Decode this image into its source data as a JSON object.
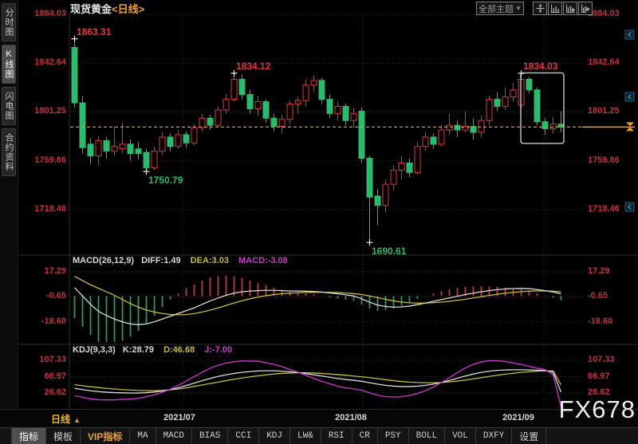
{
  "header": {
    "title_symbol": "现货黄金",
    "title_period": "<日线>",
    "theme_label": "全部主题",
    "theme_arrow": "▼"
  },
  "sidebar": {
    "items": [
      {
        "label": "分时图",
        "selected": false
      },
      {
        "label": "K线图",
        "selected": true
      },
      {
        "label": "闪电图",
        "selected": false
      },
      {
        "label": "合约资料",
        "selected": false
      }
    ]
  },
  "price_axis": {
    "labels": [
      "1884.03",
      "1842.64",
      "1801.25",
      "1759.86",
      "1718.46"
    ]
  },
  "macd": {
    "title": "MACD(26,12,9)",
    "diff_label": "DIFF:1.49",
    "dea_label": "DEA:3.03",
    "macd_label": "MACD:-3.08",
    "axis": [
      "17.29",
      "-0.65",
      "-18.60"
    ]
  },
  "kdj": {
    "title": "KDJ(9,3,3)",
    "k_label": "K:28.79",
    "d_label": "D:46.68",
    "j_label": "J:-7.00",
    "axis": [
      "107.33",
      "66.97",
      "26.62"
    ]
  },
  "timeline": {
    "period_label": "日线",
    "arrow": "▲",
    "dates": [
      "2021/07",
      "2021/08",
      "2021/09"
    ]
  },
  "watermark": "FX678",
  "toolbar": {
    "items": [
      {
        "label": "指标",
        "state": "selected"
      },
      {
        "label": "模板"
      },
      {
        "label": "VIP指标",
        "state": "vip"
      },
      {
        "label": "MA"
      },
      {
        "label": "MACD"
      },
      {
        "label": "BIAS"
      },
      {
        "label": "CCI"
      },
      {
        "label": "KDJ"
      },
      {
        "label": "LW&"
      },
      {
        "label": "RSI"
      },
      {
        "label": "CR"
      },
      {
        "label": "PSY"
      },
      {
        "label": "BOLL"
      },
      {
        "label": "VOL"
      },
      {
        "label": "DXFY"
      },
      {
        "label": "设置"
      }
    ]
  },
  "colors": {
    "up": "#e23345",
    "down": "#2eb96d",
    "axis": "#c5303c",
    "accent": "#f7a01e",
    "dea_yellow": "#c6bd2d",
    "magenta": "#cf35cf",
    "line_white": "#dadada",
    "hist_up": "#cf3344",
    "hist_down": "#2a9b5e"
  },
  "chart_data": {
    "type": "candlestick",
    "symbol": "现货黄金",
    "period": "日线",
    "price_axis_ticks": [
      1884.03,
      1842.64,
      1801.25,
      1759.86,
      1718.46
    ],
    "x_axis_labels": [
      "2021/07",
      "2021/08",
      "2021/09"
    ],
    "last_price": 1788.5,
    "candles": [
      [
        1856,
        1863.31,
        1805,
        1809
      ],
      [
        1809,
        1815,
        1766,
        1771
      ],
      [
        1774,
        1779,
        1757,
        1764
      ],
      [
        1764,
        1781,
        1756,
        1777
      ],
      [
        1777,
        1780,
        1762,
        1768
      ],
      [
        1768,
        1789,
        1764,
        1772
      ],
      [
        1770,
        1792,
        1766,
        1774
      ],
      [
        1774,
        1778,
        1760,
        1766
      ],
      [
        1770,
        1776,
        1761,
        1766
      ],
      [
        1767,
        1770,
        1750.79,
        1754
      ],
      [
        1754,
        1772,
        1752,
        1768
      ],
      [
        1768,
        1784,
        1765,
        1780
      ],
      [
        1780,
        1783,
        1768,
        1772
      ],
      [
        1772,
        1786,
        1770,
        1782
      ],
      [
        1782,
        1785,
        1771,
        1775
      ],
      [
        1775,
        1791,
        1773,
        1788
      ],
      [
        1788,
        1800,
        1785,
        1796
      ],
      [
        1796,
        1799,
        1786,
        1790
      ],
      [
        1790,
        1806,
        1788,
        1803
      ],
      [
        1803,
        1816,
        1800,
        1812
      ],
      [
        1812,
        1834.12,
        1810,
        1829
      ],
      [
        1829,
        1833,
        1812,
        1816
      ],
      [
        1816,
        1820,
        1800,
        1804
      ],
      [
        1804,
        1815,
        1798,
        1810
      ],
      [
        1810,
        1812,
        1792,
        1796
      ],
      [
        1796,
        1800,
        1785,
        1789
      ],
      [
        1789,
        1799,
        1783,
        1795
      ],
      [
        1795,
        1811,
        1791,
        1808
      ],
      [
        1808,
        1814,
        1800,
        1811
      ],
      [
        1811,
        1829,
        1806,
        1824
      ],
      [
        1824,
        1832,
        1818,
        1828
      ],
      [
        1828,
        1830,
        1808,
        1812
      ],
      [
        1812,
        1816,
        1796,
        1800
      ],
      [
        1800,
        1810,
        1794,
        1806
      ],
      [
        1806,
        1808,
        1790,
        1794
      ],
      [
        1794,
        1805,
        1788,
        1800
      ],
      [
        1802,
        1805,
        1758,
        1762
      ],
      [
        1762,
        1764,
        1690.61,
        1729
      ],
      [
        1730,
        1736,
        1705,
        1722
      ],
      [
        1722,
        1744,
        1716,
        1740
      ],
      [
        1740,
        1756,
        1735,
        1752
      ],
      [
        1752,
        1764,
        1744,
        1758
      ],
      [
        1758,
        1762,
        1746,
        1750
      ],
      [
        1750,
        1776,
        1748,
        1772
      ],
      [
        1772,
        1784,
        1768,
        1780
      ],
      [
        1780,
        1783,
        1770,
        1774
      ],
      [
        1774,
        1790,
        1772,
        1786
      ],
      [
        1786,
        1800,
        1782,
        1790
      ],
      [
        1790,
        1794,
        1780,
        1786
      ],
      [
        1786,
        1802,
        1784,
        1789
      ],
      [
        1789,
        1796,
        1778,
        1784
      ],
      [
        1784,
        1798,
        1780,
        1794
      ],
      [
        1794,
        1815,
        1790,
        1812
      ],
      [
        1812,
        1818,
        1802,
        1806
      ],
      [
        1806,
        1822,
        1803,
        1814
      ],
      [
        1814,
        1826,
        1810,
        1820
      ],
      [
        1807,
        1834.03,
        1804,
        1829
      ],
      [
        1829,
        1831,
        1817,
        1820
      ],
      [
        1820,
        1822,
        1790,
        1793
      ],
      [
        1793,
        1796,
        1782,
        1787
      ],
      [
        1787,
        1797,
        1783,
        1791
      ],
      [
        1791,
        1802,
        1784,
        1788.5
      ]
    ],
    "annotations": [
      {
        "label": "1863.31",
        "index": 0,
        "price": 1863.31,
        "side": "high",
        "trend": "up"
      },
      {
        "label": "1834.12",
        "index": 20,
        "price": 1834.12,
        "side": "high",
        "trend": "up"
      },
      {
        "label": "1750.79",
        "index": 9,
        "price": 1750.79,
        "side": "low",
        "trend": "down"
      },
      {
        "label": "1690.61",
        "index": 37,
        "price": 1690.61,
        "side": "low",
        "trend": "down"
      },
      {
        "label": "1834.03",
        "index": 56,
        "price": 1834.03,
        "side": "high",
        "trend": "up"
      }
    ],
    "highlight_box": {
      "from": 57,
      "to": 61
    },
    "macd": {
      "params": "26,12,9",
      "diff_last": 1.49,
      "dea_last": 3.03,
      "macd_last": -3.08,
      "axis_ticks": [
        17.29,
        -0.65,
        -18.6
      ],
      "diff": [
        6,
        0,
        -6,
        -11,
        -14,
        -16.5,
        -18.5,
        -20,
        -20.5,
        -20,
        -18.5,
        -16.5,
        -14.5,
        -12.5,
        -10.5,
        -8.5,
        -6,
        -3.5,
        -1.5,
        0.5,
        2,
        3,
        3.5,
        3.8,
        4,
        4,
        3.8,
        3.6,
        3.5,
        3.4,
        3.2,
        2.8,
        2.2,
        1.5,
        0.8,
        0,
        -2,
        -4.5,
        -6.5,
        -7.5,
        -8,
        -7.8,
        -7.2,
        -6.2,
        -5,
        -3.8,
        -2.6,
        -1.4,
        -0.2,
        1,
        2,
        3,
        3.8,
        4.5,
        5,
        5.3,
        5.4,
        5.2,
        4.6,
        3.8,
        2.8,
        1.49
      ],
      "dea": [
        14,
        11,
        8,
        5.5,
        3,
        0.5,
        -2.5,
        -5.5,
        -8,
        -10,
        -11.5,
        -12.5,
        -13.2,
        -13.4,
        -13.3,
        -12.6,
        -11.5,
        -10.1,
        -8.5,
        -6.8,
        -5,
        -3.4,
        -2,
        -0.8,
        0.2,
        1,
        1.6,
        2,
        2.3,
        2.5,
        2.6,
        2.65,
        2.6,
        2.4,
        2.1,
        1.7,
        1,
        0,
        -1.2,
        -2.4,
        -3.5,
        -4.3,
        -4.9,
        -5.1,
        -5.1,
        -4.8,
        -4.4,
        -3.8,
        -3.1,
        -2.3,
        -1.4,
        -0.5,
        0.4,
        1.2,
        2,
        2.6,
        3.1,
        3.4,
        3.6,
        3.6,
        3.4,
        3.03
      ]
    },
    "kdj": {
      "params": "9,3,3",
      "k_last": 28.79,
      "d_last": 46.68,
      "j_last": -7.0,
      "axis_ticks": [
        107.33,
        66.97,
        26.62
      ],
      "k": [
        38,
        35,
        32,
        30,
        28.5,
        27.5,
        27,
        26.5,
        26.5,
        27.5,
        29,
        31.5,
        35,
        39.5,
        45,
        51,
        57,
        62.5,
        67.5,
        71.5,
        75,
        77.5,
        79.5,
        81,
        81.5,
        81.5,
        80.5,
        79,
        77,
        74.5,
        71.5,
        68.5,
        65.5,
        62.5,
        60,
        58,
        55.5,
        52,
        48.5,
        45.5,
        43.5,
        42.5,
        42.5,
        43.5,
        45.5,
        48.5,
        52.5,
        57.5,
        63,
        68.5,
        73.5,
        77.5,
        80.5,
        82.5,
        83.5,
        84,
        84,
        83.5,
        83,
        82.5,
        78,
        28.79
      ],
      "d": [
        47,
        44.5,
        42,
        40,
        38,
        36.5,
        35,
        34,
        33,
        32.5,
        32.5,
        33,
        34.5,
        36.5,
        39.5,
        43,
        46.5,
        50,
        53.5,
        57,
        60.5,
        63.5,
        66.5,
        69,
        71.5,
        73.5,
        75,
        76,
        76.5,
        76.5,
        76,
        75,
        73.5,
        72,
        70.5,
        68.5,
        66.5,
        64.5,
        62,
        59.5,
        57,
        55,
        53.5,
        52.5,
        52,
        52,
        52.5,
        54,
        56,
        58.5,
        61.5,
        64.5,
        67.5,
        70.5,
        73,
        75.5,
        77.5,
        79,
        80.5,
        81.5,
        81,
        46.68
      ]
    }
  }
}
